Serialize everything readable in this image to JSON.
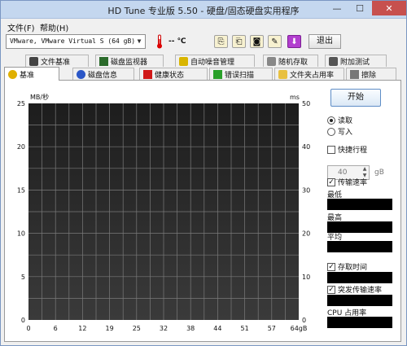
{
  "window": {
    "title": "HD Tune 专业版 5.50 - 硬盘/固态硬盘实用程序",
    "minimize": "—",
    "maximize": "☐",
    "close": "✕"
  },
  "menu": {
    "file": "文件(F)",
    "help": "帮助(H)"
  },
  "toolbar": {
    "drive": "VMware, VMware Virtual S (64 gB)",
    "temperature": "-- ℃",
    "exit_label": "退出"
  },
  "tabs_row1": [
    "文件基准",
    "磁盘监视器",
    "自动噪音管理",
    "随机存取",
    "附加测试"
  ],
  "tabs_row2": [
    "基准",
    "磁盘信息",
    "健康状态",
    "错误扫描",
    "文件夹占用率",
    "擦除"
  ],
  "chart_data": {
    "type": "line",
    "ylabel_left": "MB/秒",
    "ylabel_right": "ms",
    "yticks_left": [
      0,
      5,
      10,
      15,
      20,
      25
    ],
    "yticks_right": [
      0,
      10,
      20,
      30,
      40,
      50
    ],
    "xticks": [
      "0",
      "6",
      "12",
      "19",
      "25",
      "32",
      "38",
      "44",
      "51",
      "57",
      "64gB"
    ],
    "ylim_left": [
      0,
      25
    ],
    "ylim_right": [
      0,
      50
    ],
    "grid": true,
    "series": []
  },
  "panel": {
    "start_label": "开始",
    "read_label": "读取",
    "write_label": "写入",
    "quick_label": "快捷行程",
    "quick_value": "40",
    "quick_unit": "gB",
    "transfer_label": "传输速率",
    "min_label": "最低",
    "max_label": "最高",
    "avg_label": "平均",
    "access_label": "存取时间",
    "burst_label": "突发传输速率",
    "cpu_label": "CPU 占用率"
  }
}
